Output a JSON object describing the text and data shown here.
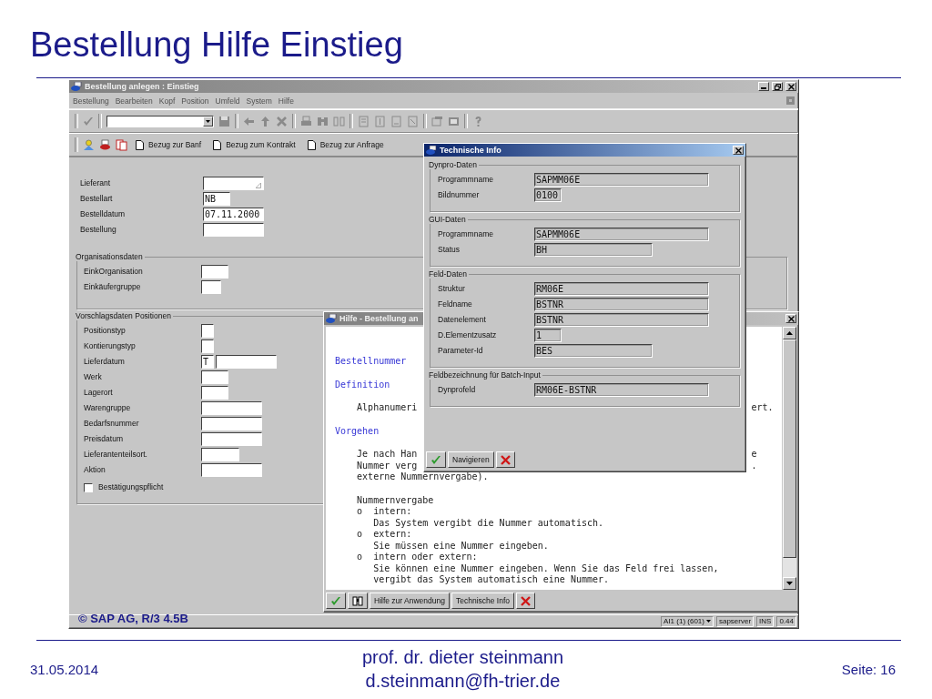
{
  "slide": {
    "title": "Bestellung Hilfe Einstieg"
  },
  "main_window": {
    "title": "Bestellung anlegen : Einstieg",
    "menu": [
      "Bestellung",
      "Bearbeiten",
      "Kopf",
      "Position",
      "Umfeld",
      "System",
      "Hilfe"
    ],
    "app_toolbar": [
      "Bezug zur Banf",
      "Bezug zum Kontrakt",
      "Bezug zur Anfrage"
    ],
    "header_fields": [
      {
        "label": "Lieferant",
        "kind": "search"
      },
      {
        "label": "Bestellart",
        "kind": "text",
        "value": "NB"
      },
      {
        "label": "Bestelldatum",
        "kind": "text",
        "value": "07.11.2000"
      },
      {
        "label": "Bestellung",
        "kind": "text"
      }
    ],
    "groups": [
      {
        "title": "Organisationsdaten",
        "fields": [
          {
            "label": "EinkOrganisation",
            "kind": "text"
          },
          {
            "label": "Einkäufergruppe",
            "kind": "text"
          }
        ]
      },
      {
        "title": "Vorschlagsdaten Positionen",
        "fields": [
          {
            "label": "Positionstyp",
            "kind": "text"
          },
          {
            "label": "Kontierungstyp",
            "kind": "text"
          },
          {
            "label": "Lieferdatum",
            "kind": "date",
            "value": "T"
          },
          {
            "label": "Werk",
            "kind": "text"
          },
          {
            "label": "Lagerort",
            "kind": "text"
          },
          {
            "label": "Warengruppe",
            "kind": "text"
          },
          {
            "label": "Bedarfsnummer",
            "kind": "text"
          },
          {
            "label": "Preisdatum",
            "kind": "text"
          },
          {
            "label": "Lieferantenteilsort.",
            "kind": "text"
          },
          {
            "label": "Aktion",
            "kind": "text"
          }
        ],
        "checkbox": {
          "label": "Bestätigungspflicht",
          "checked": false
        }
      }
    ],
    "status_bar": {
      "copyright": "© SAP AG, R/3 4.5B",
      "session": "AI1 (1) (601)",
      "server": "sapserver",
      "mode": "INS",
      "time": "0.44"
    }
  },
  "help_window": {
    "title": "Hilfe - Bestellung an",
    "paragraphs": [
      {
        "kind": "heading",
        "lines": [
          {
            "kind": "plain",
            "text": "Bestellnummer"
          }
        ]
      },
      {
        "kind": "heading",
        "lines": [
          {
            "kind": "plain",
            "text": "Definition"
          }
        ]
      },
      {
        "kind": "body",
        "lines": [
          {
            "kind": "plain",
            "text": "Alphanumeri",
            "tail": "ert."
          }
        ]
      },
      {
        "kind": "heading",
        "lines": [
          {
            "kind": "plain",
            "text": "Vorgehen"
          }
        ]
      },
      {
        "kind": "body",
        "lines": [
          {
            "kind": "plain",
            "text": "Je nach Han",
            "tail": "e"
          },
          {
            "kind": "plain",
            "text": "Nummer verg",
            "tail": "."
          },
          {
            "kind": "plain",
            "text": "externe Nummernvergabe)."
          }
        ]
      },
      {
        "kind": "body",
        "lines": [
          {
            "kind": "plain",
            "text": "Nummernvergabe"
          },
          {
            "kind": "bullet",
            "marker": "o",
            "text": "intern:"
          },
          {
            "kind": "sub",
            "text": "Das System vergibt die Nummer automatisch."
          },
          {
            "kind": "bullet",
            "marker": "o",
            "text": "extern:"
          },
          {
            "kind": "sub",
            "text": "Sie müssen eine Nummer eingeben."
          },
          {
            "kind": "bullet",
            "marker": "o",
            "text": "intern oder extern:"
          },
          {
            "kind": "sub",
            "text": "Sie können eine Nummer eingeben. Wenn Sie das Feld frei lassen,"
          },
          {
            "kind": "sub",
            "text": "vergibt das System automatisch eine Nummer."
          }
        ]
      }
    ],
    "buttons": [
      "Hilfe zur Anwendung",
      "Technische Info"
    ]
  },
  "tech_info_dialog": {
    "title": "Technische Info",
    "groups": [
      {
        "title": "Dynpro-Daten",
        "fields": [
          {
            "label": "Programmname",
            "value": "SAPMM06E"
          },
          {
            "label": "Bildnummer",
            "value": "0100"
          }
        ]
      },
      {
        "title": "GUI-Daten",
        "fields": [
          {
            "label": "Programmname",
            "value": "SAPMM06E"
          },
          {
            "label": "Status",
            "value": "BH"
          }
        ]
      },
      {
        "title": "Feld-Daten",
        "fields": [
          {
            "label": "Struktur",
            "value": "RM06E"
          },
          {
            "label": "Feldname",
            "value": "BSTNR"
          },
          {
            "label": "Datenelement",
            "value": "BSTNR"
          },
          {
            "label": "D.Elementzusatz",
            "value": "1"
          },
          {
            "label": "Parameter-Id",
            "value": "BES"
          }
        ]
      },
      {
        "title": "Feldbezeichnung für Batch-Input",
        "fields": [
          {
            "label": "Dynprofeld",
            "value": "RM06E-BSTNR"
          }
        ]
      }
    ],
    "buttons": [
      "Navigieren"
    ]
  },
  "footer": {
    "date": "31.05.2014",
    "author": "prof. dr. dieter steinmann",
    "email": "d.steinmann@fh-trier.de",
    "page": "Seite: 16"
  }
}
